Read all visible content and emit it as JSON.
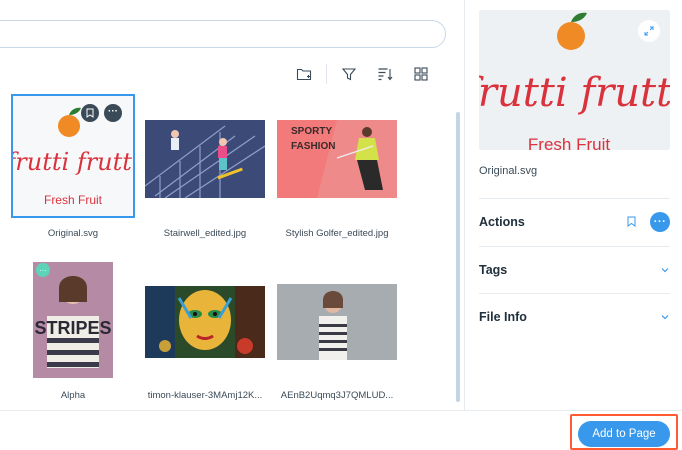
{
  "toolbar": {
    "icons": [
      "new-folder-icon",
      "filter-icon",
      "sort-icon",
      "grid-view-icon"
    ]
  },
  "media_items": [
    {
      "caption": "Original.svg",
      "selected": true
    },
    {
      "caption": "Stairwell_edited.jpg",
      "selected": false
    },
    {
      "caption": "Stylish Golfer_edited.jpg",
      "selected": false
    },
    {
      "caption": "Alpha",
      "selected": false
    },
    {
      "caption": "timon-klauser-3MAmj12K...",
      "selected": false
    },
    {
      "caption": "AEnB2Uqmq3J7QMLUD...",
      "selected": false
    }
  ],
  "thumb_text": {
    "frutti": "frutti frutti",
    "fresh": "Fresh Fruit",
    "sporty": "SPORTY",
    "fashion": "FASHION",
    "stripes": "STRIPES"
  },
  "panel": {
    "filename": "Original.svg",
    "sections": {
      "actions": "Actions",
      "tags": "Tags",
      "file_info": "File Info"
    }
  },
  "footer": {
    "add_label": "Add to Page"
  },
  "colors": {
    "accent": "#3899ec",
    "highlight": "#ff5a34",
    "fruit_red": "#d9323c",
    "orange": "#f08a24"
  }
}
